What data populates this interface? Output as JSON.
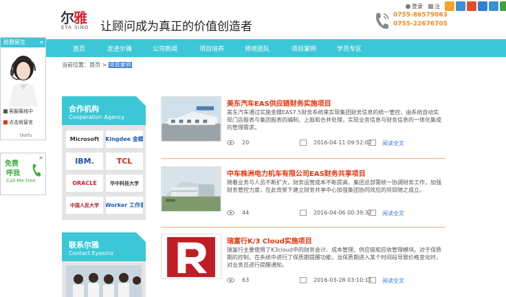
{
  "header": {
    "logo_cn_a": "尔",
    "logo_cn_b": "雅",
    "logo_en": "EYA SINO",
    "slogan": "让顾问成为真正的价值创造者",
    "login": "登录",
    "register": "注",
    "phone1": "0755-86579063",
    "phone2": "0755-22676705"
  },
  "social_colors": [
    "#f4a623",
    "#3b8fd6",
    "#e44c2b",
    "#2f7ed8",
    "#3b8fd6",
    "#3aa43a"
  ],
  "nav": {
    "items": [
      "首页",
      "走进尔雅",
      "公司新闻",
      "项目培养",
      "师资团队",
      "项目案例",
      "学员专区"
    ]
  },
  "breadcrumb": {
    "prefix": "当前位置：",
    "home": "首页",
    "sep": " > ",
    "current": "项目案例"
  },
  "msg_widget": {
    "title": "给我留言",
    "close": "×",
    "row1": "客服离线中",
    "row2": "点击就留言",
    "foot": "tkefu"
  },
  "call_widget": {
    "line1": "免费",
    "line2": "呼我",
    "line3": "Call Me Free",
    "close": "×"
  },
  "partners": {
    "title": "合作机构",
    "subtitle": "Cooperation Agency",
    "logos": [
      "Microsoft",
      "Kingdee 金蝶",
      "IBM.",
      "TCL",
      "ORACLE",
      "华中科技大学",
      "中国人民大学",
      "iWorker 工作家"
    ]
  },
  "contact": {
    "title": "联系尔雅",
    "subtitle": "Contact Eyasino"
  },
  "articles": [
    {
      "title": "美东汽车EAS供应链财务实施项目",
      "desc": "美东汽车通过实施金蝶EAS7.5财务系统来实现集团财务信息的统一管控，由系统自动实现门店报表与集团报表的编制、上报和合并处理，实现业务信息与财务信息的一体化集成的管理需求。",
      "views": "20",
      "date": "2016-04-11 09:52:02",
      "read": "阅读全文"
    },
    {
      "title": "中车株洲电力机车有限公司EAS财务共享项目",
      "desc": "随着业务与人员不断扩大，财务运营成本不断提高，集团总部需统一协调财务工作，加强财务管控力度，在此背景下建立财务共享中心加强集团协同效应的项目随之成立。",
      "views": "44",
      "date": "2016-04-06 00:39:32",
      "read": "阅读全文"
    },
    {
      "title": "瑞富行K/3 Cloud实施项目",
      "desc": "瑞富行主要使用了K3cloud中的财务会计、成本管理、供应链和应收管理模块。对于保质期的控制，在系统中进行了保质期提醒功能，当保质期进入某个时间段导致价格变化时，对业务员进行提醒通知。",
      "views": "63",
      "date": "2016-03-28 03:10:11",
      "read": "阅读全文"
    }
  ]
}
